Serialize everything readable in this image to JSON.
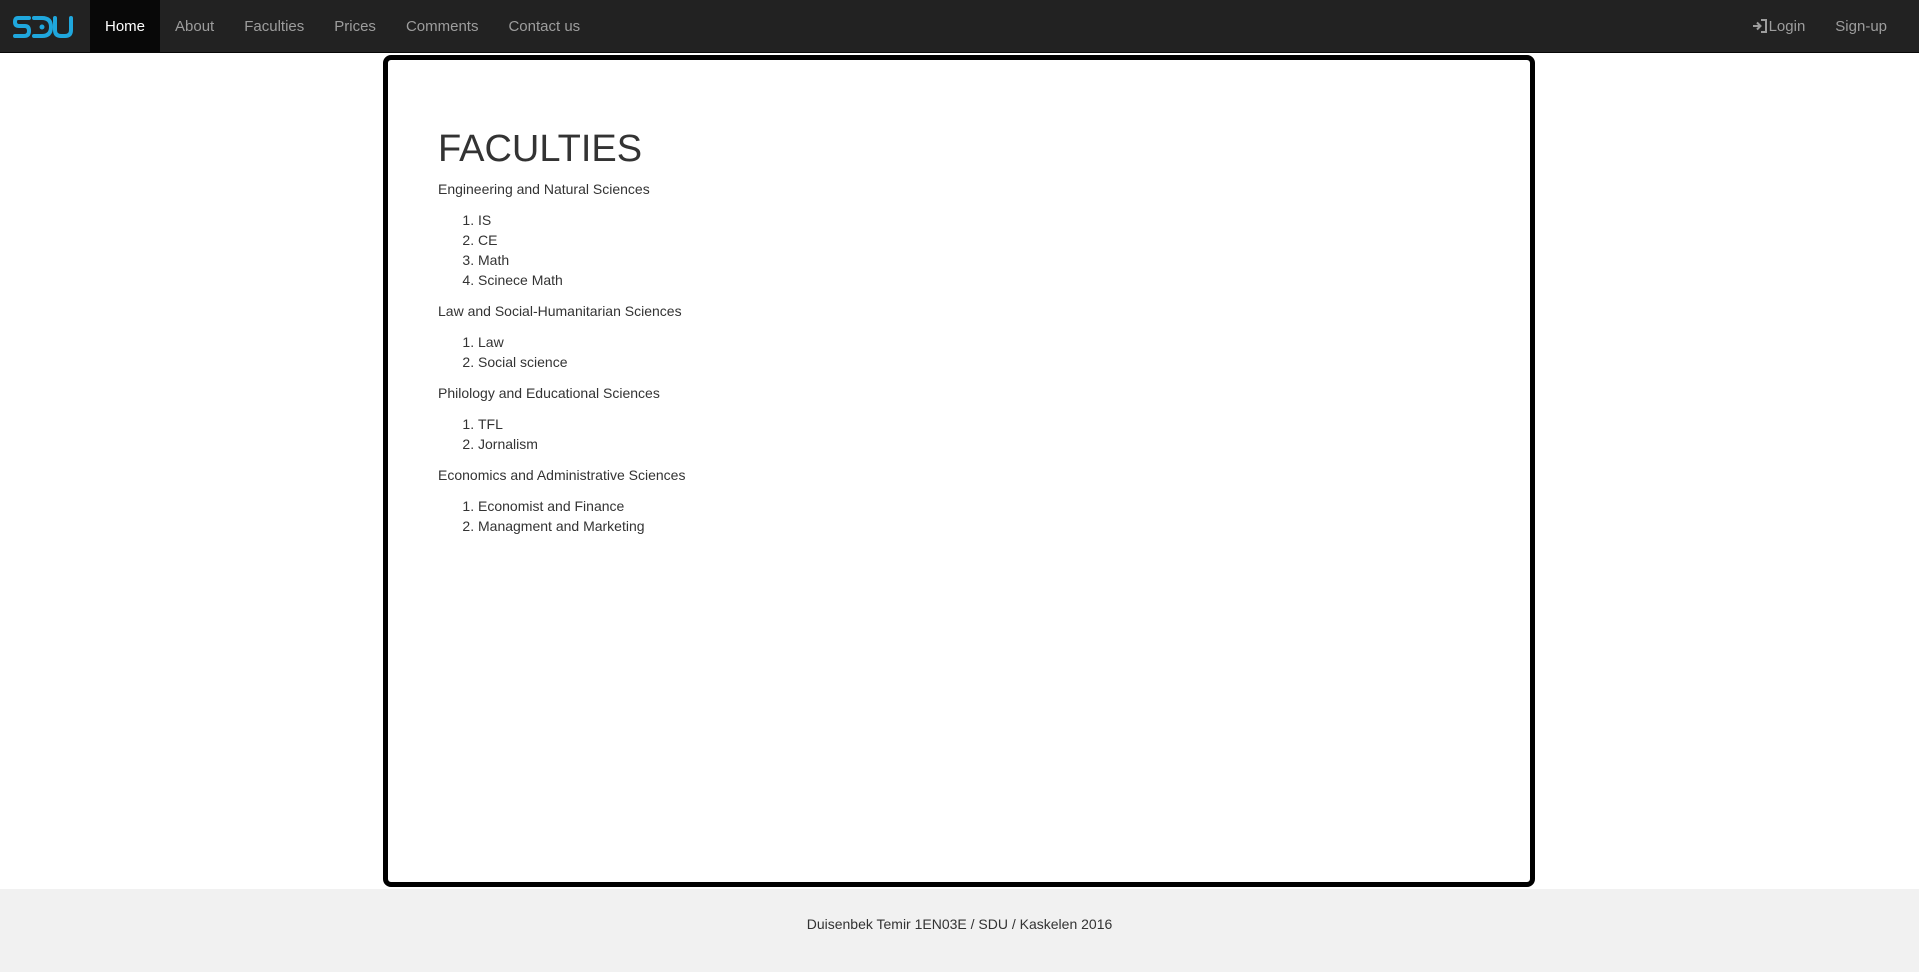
{
  "brand": {
    "logo_text": "SDU",
    "color": "#1fa7dd"
  },
  "nav": {
    "items": [
      {
        "label": "Home",
        "active": true
      },
      {
        "label": "About"
      },
      {
        "label": "Faculties"
      },
      {
        "label": "Prices"
      },
      {
        "label": "Comments"
      },
      {
        "label": "Contact us"
      }
    ],
    "login_label": "Login",
    "login_icon": "login-icon",
    "signup_label": "Sign-up"
  },
  "main": {
    "title": "FACULTIES",
    "faculties": [
      {
        "name": "Engineering and Natural Sciences",
        "departments": [
          "IS",
          "CE",
          "Math",
          "Scinece Math"
        ]
      },
      {
        "name": "Law and Social-Humanitarian Sciences",
        "departments": [
          "Law",
          "Social science"
        ]
      },
      {
        "name": "Philology and Educational Sciences",
        "departments": [
          "TFL",
          "Jornalism"
        ]
      },
      {
        "name": "Economics and Administrative Sciences",
        "departments": [
          "Economist and Finance",
          "Managment and Marketing"
        ]
      }
    ]
  },
  "footer": {
    "text": "Duisenbek Temir 1EN03E / SDU / Kaskelen 2016"
  }
}
